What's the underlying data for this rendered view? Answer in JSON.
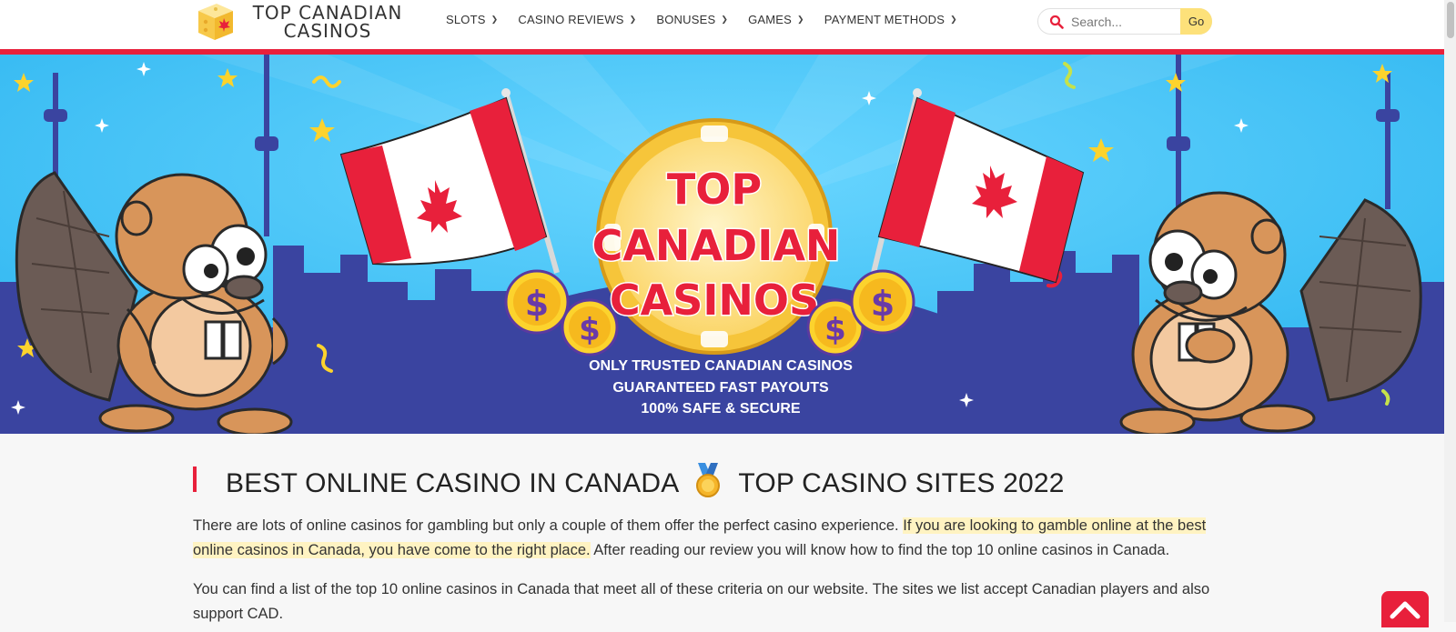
{
  "site": {
    "logo_line1": "TOP CANADIAN",
    "logo_line2": "CASINOS",
    "logo_icon": "dice-icon"
  },
  "nav": {
    "items": [
      {
        "label": "SLOTS"
      },
      {
        "label": "CASINO REVIEWS"
      },
      {
        "label": "BONUSES"
      },
      {
        "label": "GAMES"
      },
      {
        "label": "PAYMENT METHODS"
      }
    ]
  },
  "search": {
    "placeholder": "Search...",
    "button_label": "Go"
  },
  "banner": {
    "chip_line1": "TOP",
    "chip_line2": "CANADIAN",
    "chip_line3": "CASINOS",
    "tagline1": "ONLY TRUSTED CANADIAN CASINOS",
    "tagline2": "GUARANTEED FAST PAYOUTS",
    "tagline3": "100% SAFE & SECURE",
    "coin_symbol": "$"
  },
  "article": {
    "heading_part1": "BEST ONLINE CASINO IN CANADA",
    "heading_part2": "TOP CASINO SITES 2022",
    "p1_a": "There are lots of online casinos for gambling but only a couple of them offer the perfect casino experience. ",
    "p1_highlight": "If you are looking to gamble online at the best online casinos in Canada, you have come to the right place.",
    "p1_b": " After reading our review you will know how to find the top 10 online casinos in Canada.",
    "p2": "You can find a list of the top 10 online casinos in Canada that meet all of these criteria on our website. The sites we list accept Canadian players and also support CAD."
  },
  "colors": {
    "accent_red": "#e8203b",
    "banner_sky": "#3cc3f5",
    "city_blue": "#3f4aa0",
    "search_button": "#fde17a"
  }
}
